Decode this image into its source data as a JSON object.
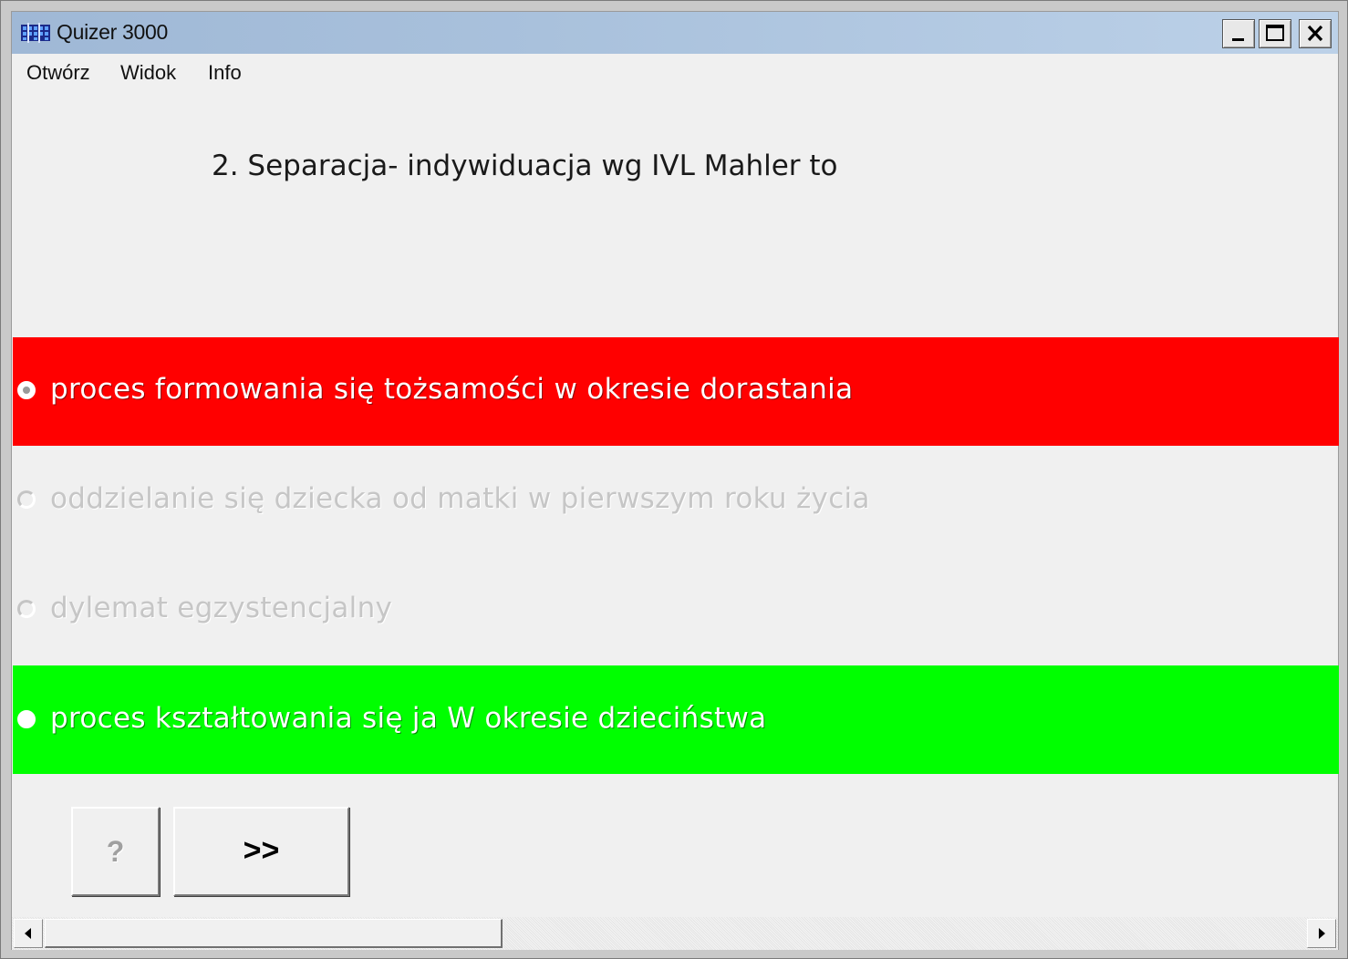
{
  "window": {
    "title": "Quizer 3000",
    "icon": "app-grid-icon",
    "controls": {
      "minimize": "minimize-icon",
      "maximize": "maximize-icon",
      "close": "close-icon"
    }
  },
  "menu": {
    "items": [
      "Otwórz",
      "Widok",
      "Info"
    ]
  },
  "quiz": {
    "question": "2. Separacja- indywiduacja wg IVL Mahler to",
    "answers": [
      {
        "text": "proces formowania się tożsamości w okresie dorastania",
        "state": "selected-wrong",
        "color": "#ff0000"
      },
      {
        "text": "oddzielanie się dziecka od matki w pierwszym roku życia",
        "state": "disabled"
      },
      {
        "text": "dylemat egzystencjalny",
        "state": "disabled"
      },
      {
        "text": "proces kształtowania się ja W okresie dzieciństwa",
        "state": "correct",
        "color": "#00ff00"
      }
    ]
  },
  "buttons": {
    "help_label": "?",
    "next_label": ">>"
  },
  "scrollbar": {
    "left_arrow": "scroll-left-icon",
    "right_arrow": "scroll-right-icon"
  }
}
